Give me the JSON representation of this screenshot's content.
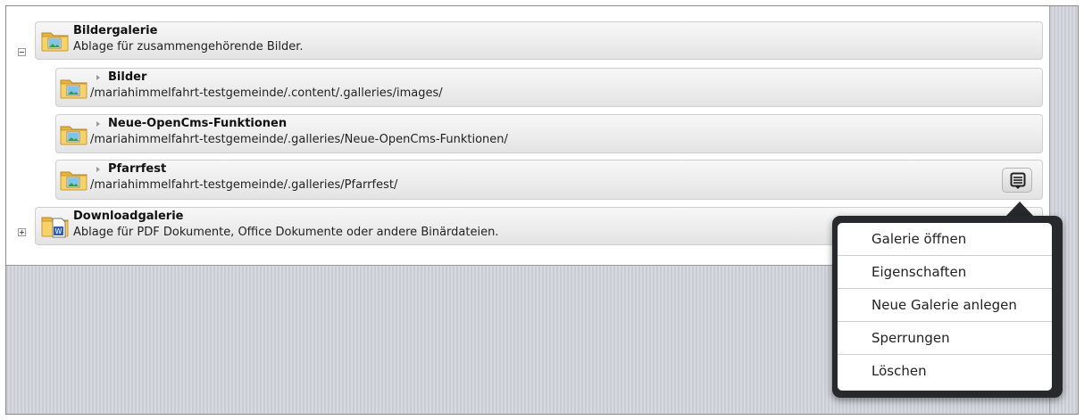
{
  "galleries": [
    {
      "title": "Bildergalerie",
      "description": "Ablage für zusammengehörende Bilder.",
      "icon": "image-folder-icon",
      "expanded": true,
      "children": [
        {
          "title": "Bilder",
          "path": "/mariahimmelfahrt-testgemeinde/.content/.galleries/images/",
          "icon": "image-folder-icon"
        },
        {
          "title": "Neue-OpenCms-Funktionen",
          "path": "/mariahimmelfahrt-testgemeinde/.galleries/Neue-OpenCms-Funktionen/",
          "icon": "image-folder-icon"
        },
        {
          "title": "Pfarrfest",
          "path": "/mariahimmelfahrt-testgemeinde/.galleries/Pfarrfest/",
          "icon": "image-folder-icon"
        }
      ]
    },
    {
      "title": "Downloadgalerie",
      "description": "Ablage für PDF Dokumente, Office Dokumente oder andere Binärdateien.",
      "icon": "document-folder-icon",
      "expanded": false
    }
  ],
  "context_menu": {
    "items": [
      "Galerie öffnen",
      "Eigenschaften",
      "Neue Galerie anlegen",
      "Sperrungen",
      "Löschen"
    ]
  },
  "colors": {
    "popup_border": "#27292c",
    "row_border": "#cfcfcf",
    "folder_yellow": "#f0c24a"
  }
}
